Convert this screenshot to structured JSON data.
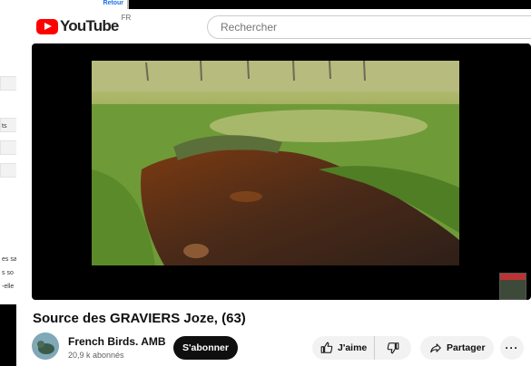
{
  "background_window": {
    "top_right_label": "Retour",
    "snippets": [
      "ts",
      "es sa",
      "s so",
      "-elle"
    ]
  },
  "header": {
    "logo_text": "YouTube",
    "country_code": "FR",
    "search_placeholder": "Rechercher"
  },
  "video": {
    "title": "Source des GRAVIERS Joze, (63)"
  },
  "channel": {
    "name": "French Birds. AMB",
    "subscribers": "20,9 k abonnés",
    "subscribe_label": "S'abonner"
  },
  "actions": {
    "like_label": "J'aime",
    "share_label": "Partager",
    "more_label": "···"
  },
  "icons": [
    "youtube-logo-icon",
    "thumb-up-icon",
    "thumb-down-icon",
    "share-arrow-icon",
    "more-icon"
  ],
  "colors": {
    "brand_red": "#ff0000",
    "subscribe_bg": "#0f0f0f",
    "pill_bg": "#f2f2f2"
  }
}
